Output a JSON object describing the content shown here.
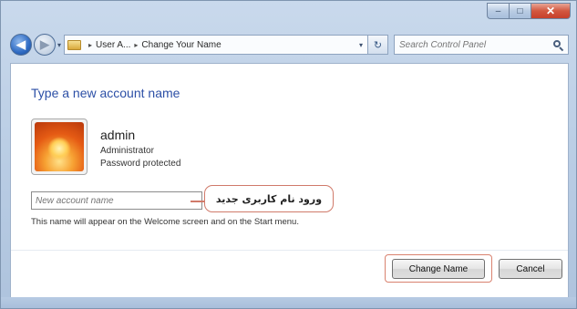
{
  "window": {
    "caption": {
      "minimize_glyph": "–",
      "maximize_glyph": "□",
      "close_glyph": "✕"
    }
  },
  "navigation": {
    "back_glyph": "◀",
    "forward_glyph": "▶",
    "dropdown_glyph": "▾"
  },
  "address_bar": {
    "breadcrumbs": [
      "User A...",
      "Change Your Name"
    ],
    "separator": "▸",
    "dropdown_glyph": "▾",
    "refresh_glyph": "↻",
    "icons": {
      "folder": "control-panel-folder-icon",
      "refresh": "refresh-icon",
      "search": "search-icon"
    }
  },
  "search": {
    "placeholder": "Search Control Panel"
  },
  "content": {
    "heading": "Type a new account name",
    "user": {
      "name": "admin",
      "role": "Administrator",
      "status": "Password protected",
      "picture": "flower-avatar-icon"
    },
    "new_name_input": {
      "placeholder": "New account name",
      "value": ""
    },
    "callout_text": "ورود نام کاربری جدید",
    "hint_text": "This name will appear on the Welcome screen and on the Start menu.",
    "buttons": {
      "change_name": "Change Name",
      "cancel": "Cancel"
    }
  },
  "colors": {
    "heading": "#2c4fa6",
    "highlight": "#d9826f",
    "chrome": "#b7cbe3"
  }
}
